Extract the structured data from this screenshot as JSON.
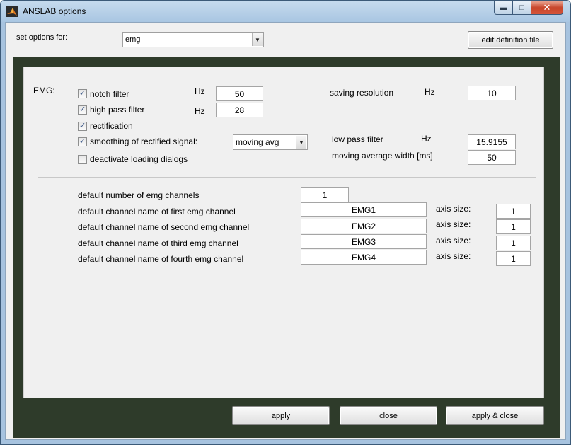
{
  "window": {
    "title": "ANSLAB options"
  },
  "top": {
    "set_options_label": "set options for:",
    "module_select": "emg",
    "edit_button": "edit definition file"
  },
  "emg": {
    "section_label": "EMG:",
    "notch_filter": {
      "label": "notch filter",
      "checked": true,
      "unit": "Hz",
      "value": "50"
    },
    "high_pass_filter": {
      "label": "high pass filter",
      "checked": true,
      "unit": "Hz",
      "value": "28"
    },
    "rectification": {
      "label": "rectification",
      "checked": true
    },
    "smoothing": {
      "label": "smoothing of rectified signal:",
      "checked": true,
      "method": "moving avg"
    },
    "deactivate_dialogs": {
      "label": "deactivate loading dialogs",
      "checked": false
    },
    "saving_resolution": {
      "label": "saving resolution",
      "unit": "Hz",
      "value": "10"
    },
    "low_pass_filter": {
      "label": "low pass filter",
      "unit": "Hz",
      "value": "15.9155"
    },
    "moving_average_width": {
      "label": "moving average width [ms]",
      "value": "50"
    }
  },
  "channels": {
    "count_label": "default number of emg channels",
    "count_value": "1",
    "axis_label": "axis size:",
    "rows": [
      {
        "label": "default channel name of first emg channel",
        "name": "EMG1",
        "axis": "1"
      },
      {
        "label": "default channel name of second emg channel",
        "name": "EMG2",
        "axis": "1"
      },
      {
        "label": "default channel name of third emg channel",
        "name": "EMG3",
        "axis": "1"
      },
      {
        "label": "default channel name of fourth emg channel",
        "name": "EMG4",
        "axis": "1"
      }
    ]
  },
  "footer": {
    "apply": "apply",
    "close": "close",
    "apply_close": "apply & close"
  },
  "icons": {
    "app": "matlab-logo-icon",
    "minimize": "minimize-icon",
    "maximize": "maximize-icon",
    "close": "close-icon"
  }
}
